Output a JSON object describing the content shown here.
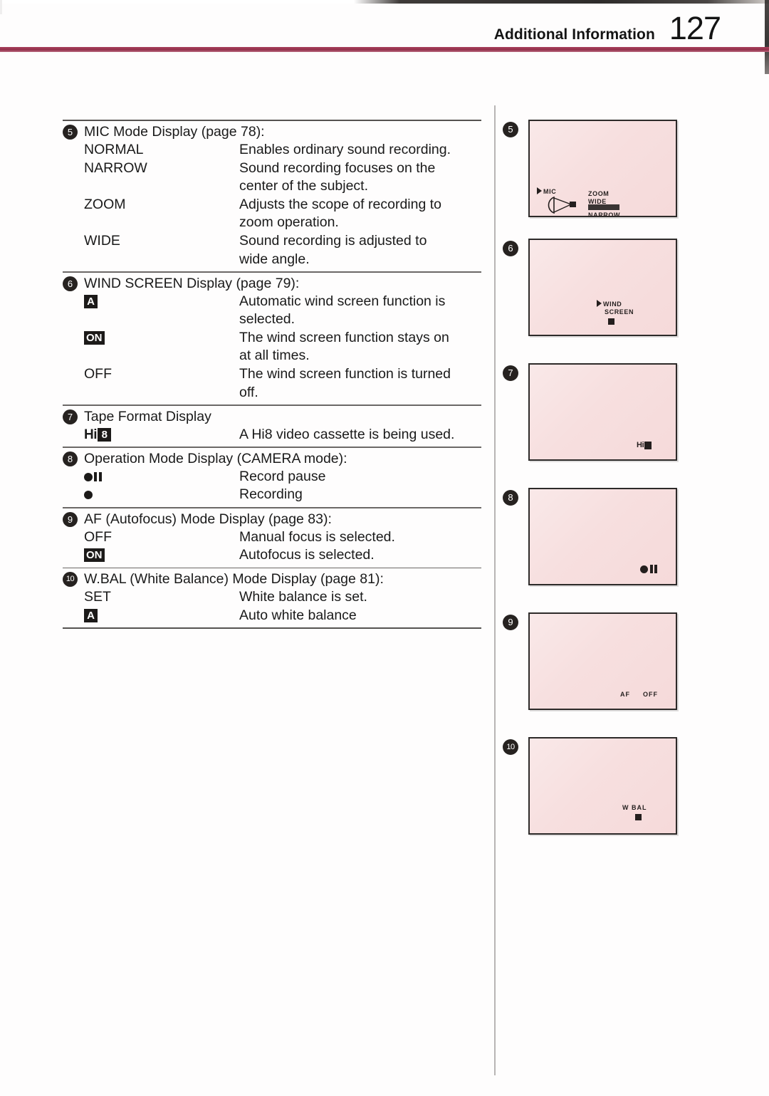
{
  "header": {
    "title": "Additional Information",
    "page_number": "127"
  },
  "sections": [
    {
      "number": "5",
      "title": "MIC Mode Display (page 78):",
      "rows": [
        {
          "term": "NORMAL",
          "term_kind": "text",
          "desc": "Enables ordinary sound recording."
        },
        {
          "term": "NARROW",
          "term_kind": "text",
          "desc": "Sound recording focuses on the",
          "desc2": "center of the subject."
        },
        {
          "term": "ZOOM",
          "term_kind": "text",
          "desc": "Adjusts the scope of recording to",
          "desc2": "zoom operation."
        },
        {
          "term": "WIDE",
          "term_kind": "text",
          "desc": "Sound recording is adjusted to",
          "desc2": "wide angle."
        }
      ]
    },
    {
      "number": "6",
      "title": "WIND SCREEN Display (page 79):",
      "rows": [
        {
          "term": "A",
          "term_kind": "inverted-badge",
          "desc": "Automatic wind screen function is",
          "desc2": "selected."
        },
        {
          "term": "ON",
          "term_kind": "inverted-badge",
          "desc": "The wind screen function stays on",
          "desc2": "at all times."
        },
        {
          "term": "OFF",
          "term_kind": "text",
          "desc": "The wind screen function is turned",
          "desc2": "off."
        }
      ]
    },
    {
      "number": "7",
      "title": "Tape Format Display",
      "rows": [
        {
          "term": "Hi8",
          "term_kind": "hi8-logo",
          "desc": "A Hi8 video cassette is being used."
        }
      ]
    },
    {
      "number": "8",
      "title": "Operation Mode Display (CAMERA mode):",
      "rows": [
        {
          "term": "",
          "term_kind": "record-pause-icon",
          "desc": "Record pause"
        },
        {
          "term": "",
          "term_kind": "record-icon",
          "desc": "Recording"
        }
      ]
    },
    {
      "number": "9",
      "title": "AF (Autofocus) Mode Display (page 83):",
      "rows": [
        {
          "term": "OFF",
          "term_kind": "text",
          "desc": "Manual focus is selected."
        },
        {
          "term": "ON",
          "term_kind": "inverted-badge",
          "desc": "Autofocus is selected."
        }
      ]
    },
    {
      "number": "10",
      "title": "W.BAL (White Balance) Mode Display (page 81):",
      "rows": [
        {
          "term": "SET",
          "term_kind": "text",
          "desc": "White balance is set."
        },
        {
          "term": "A",
          "term_kind": "inverted-badge",
          "desc": "Auto white balance"
        }
      ]
    }
  ],
  "illustrations": [
    {
      "number": "5",
      "caption_labels": [
        "MIC",
        "ZOOM",
        "WIDE",
        "NARROW"
      ],
      "mic_label": "MIC",
      "zoom_label": "ZOOM",
      "wide_label": "WIDE",
      "narrow_label": "NARROW"
    },
    {
      "number": "6",
      "wind_label": "WIND",
      "screen_label": "SCREEN"
    },
    {
      "number": "7",
      "hi8_label": "Hi"
    },
    {
      "number": "8",
      "mode": "record-pause"
    },
    {
      "number": "9",
      "af_label": "AF",
      "af_state": "OFF"
    },
    {
      "number": "10",
      "wbal_label": "W BAL"
    }
  ],
  "colors": {
    "header_rule": "#9e3550",
    "viewfinder_screen": "#f7dfdf",
    "ink": "#1a1a1a"
  }
}
